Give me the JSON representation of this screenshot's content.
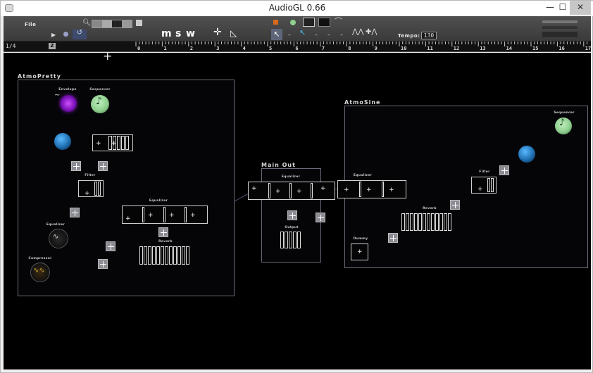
{
  "window": {
    "title": "AudioGL 0.66",
    "min": "—",
    "max": "☐",
    "close": "✕"
  },
  "toolbar": {
    "file_label": "File",
    "mode_m": "m",
    "mode_s": "s",
    "mode_w": "w",
    "tempo_label": "Tempo:",
    "tempo_value": "130"
  },
  "ruler": {
    "page": "1/4",
    "zoom": "Z",
    "ticks": [
      "0",
      "1",
      "2",
      "3",
      "4",
      "5",
      "6",
      "7",
      "8",
      "9",
      "10",
      "11",
      "12",
      "13",
      "14",
      "15",
      "16",
      "17"
    ]
  },
  "groups": {
    "atmopretty": {
      "title": "AtmoPretty",
      "envelope": "Envelope",
      "sequencer": "Sequencer",
      "filter": "Filter",
      "equalizer": "Equalizer",
      "equalizer2": "Equalizer",
      "reverb": "Reverb",
      "compressor": "Compressor"
    },
    "mainout": {
      "title": "Main Out",
      "equalizer": "Equalizer",
      "output": "Output"
    },
    "atmosine": {
      "title": "AtmoSine",
      "sequencer": "Sequencer",
      "filter": "Filter",
      "equalizer": "Equalizer",
      "reverb": "Reverb",
      "dummy": "Dummy"
    }
  },
  "icons": {
    "envelope": "wave-icon",
    "sequencer": "note-icon",
    "colors": {
      "purple": "#9a2bd6",
      "green": "#8fcf8f",
      "blue": "#1e6fb0",
      "gold": "#c79a2a",
      "orange": "#d86a1a",
      "teal": "#49c7a8"
    }
  }
}
